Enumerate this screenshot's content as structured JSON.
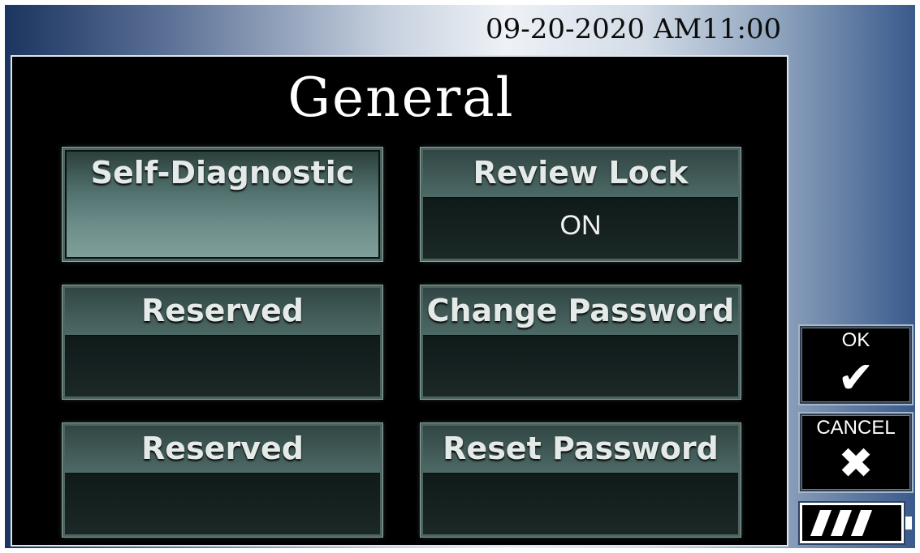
{
  "header": {
    "datetime": "09-20-2020 AM11:00"
  },
  "screen": {
    "title": "General",
    "tiles": [
      {
        "label": "Self-Diagnostic",
        "value": ""
      },
      {
        "label": "Review Lock",
        "value": "ON"
      },
      {
        "label": "Reserved",
        "value": ""
      },
      {
        "label": "Change Password",
        "value": ""
      },
      {
        "label": "Reserved",
        "value": ""
      },
      {
        "label": "Reset Password",
        "value": ""
      }
    ]
  },
  "side": {
    "ok_label": "OK",
    "ok_glyph": "✔",
    "cancel_label": "CANCEL",
    "cancel_glyph": "✖"
  },
  "icons": {
    "ok": "checkmark-icon",
    "cancel": "x-icon",
    "battery": "battery-icon"
  },
  "battery": {
    "level": 0.75
  }
}
